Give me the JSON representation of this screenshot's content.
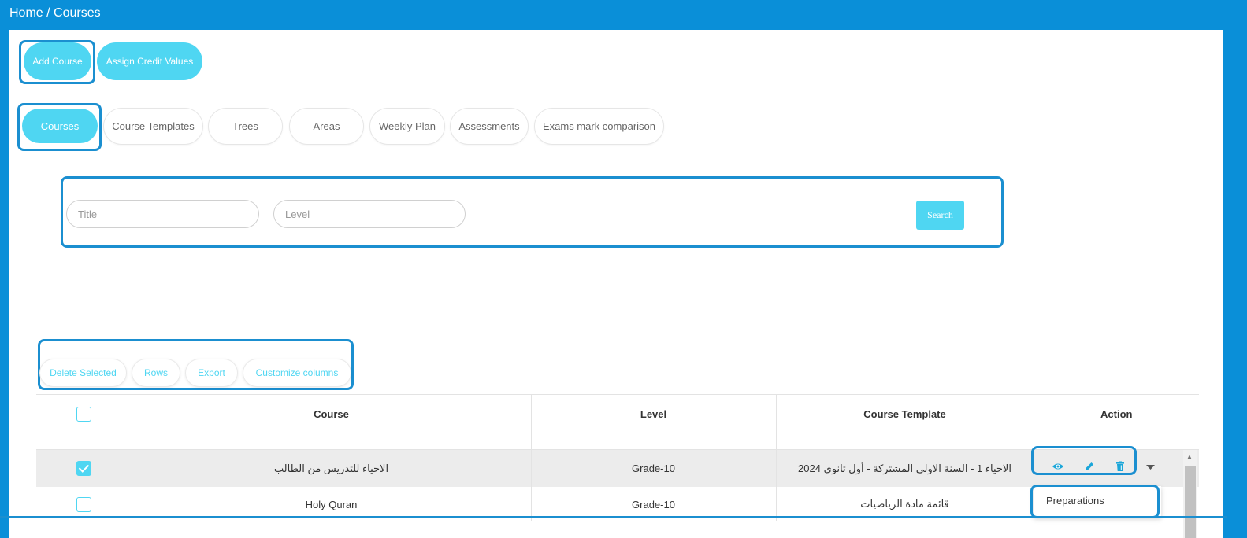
{
  "breadcrumb": "Home / Courses",
  "actions": {
    "add_course": "Add Course",
    "assign_credit_values": "Assign Credit Values"
  },
  "tabs": [
    {
      "label": "Courses",
      "active": true
    },
    {
      "label": "Course Templates",
      "active": false
    },
    {
      "label": "Trees",
      "active": false
    },
    {
      "label": "Areas",
      "active": false
    },
    {
      "label": "Weekly Plan",
      "active": false
    },
    {
      "label": "Assessments",
      "active": false
    },
    {
      "label": "Exams mark comparison",
      "active": false
    }
  ],
  "filters": {
    "title_placeholder": "Title",
    "level_placeholder": "Level",
    "search_label": "Search"
  },
  "toolbar": {
    "delete_selected": "Delete Selected",
    "rows": "Rows",
    "export": "Export",
    "customize_columns": "Customize columns"
  },
  "table": {
    "columns": [
      "Course",
      "Level",
      "Course Template",
      "Action"
    ],
    "rows": [
      {
        "course": "الاحياء للتدريس من الطالب",
        "level": "Grade-10",
        "template": "الاحياء 1 - السنة الاولي المشتركة - أول ثانوي 2024",
        "checked": true
      },
      {
        "course": "Holy Quran",
        "level": "Grade-10",
        "template": "قائمة مادة الرياضيات",
        "checked": false
      }
    ]
  },
  "row_menu": {
    "preparations": "Preparations"
  },
  "colors": {
    "brand": "#0a8fd8",
    "accent": "#4fd6f2",
    "highlight": "#1b8fd0"
  }
}
